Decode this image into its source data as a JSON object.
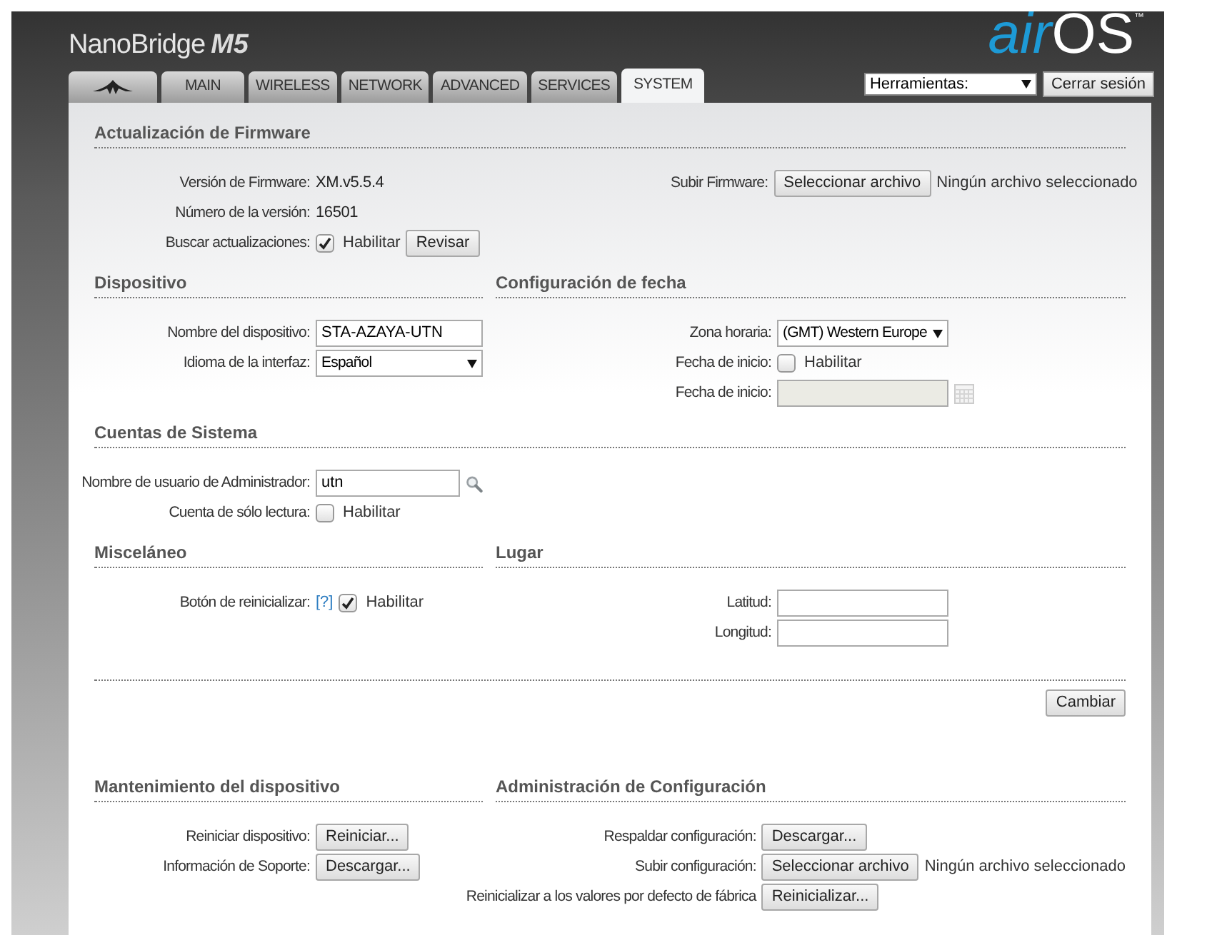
{
  "header": {
    "product": "NanoBridge",
    "model": "M5",
    "brand_air": "air",
    "brand_os": "OS",
    "trademark": "™"
  },
  "tabs": [
    {
      "kind": "logo",
      "selected": false
    },
    {
      "label": "MAIN",
      "selected": false
    },
    {
      "label": "WIRELESS",
      "selected": false
    },
    {
      "label": "NETWORK",
      "selected": false
    },
    {
      "label": "ADVANCED",
      "selected": false
    },
    {
      "label": "SERVICES",
      "selected": false
    },
    {
      "label": "SYSTEM",
      "selected": true
    }
  ],
  "tools": {
    "select": "Herramientas:",
    "logout": "Cerrar sesión"
  },
  "sections": [
    {
      "kind": "form",
      "headings": [
        "Actualización de Firmware"
      ],
      "columns": [
        [
          {
            "kind": "text",
            "label": "Versión de Firmware:",
            "value": "XM.v5.5.4"
          },
          {
            "kind": "text",
            "label": "Número de la versión:",
            "value": "16501"
          },
          {
            "kind": "checkbox",
            "label": "Buscar actualizaciones:",
            "checked": true,
            "option": "Habilitar",
            "button": "Revisar"
          }
        ],
        [
          {
            "kind": "file",
            "label": "Subir Firmware:",
            "button": "Seleccionar archivo",
            "status": "Ningún archivo seleccionado"
          }
        ]
      ]
    },
    {
      "kind": "form",
      "headings": [
        "Dispositivo",
        "Configuración de fecha"
      ],
      "columns": [
        [
          {
            "kind": "input",
            "label": "Nombre del dispositivo:",
            "value": "STA-AZAYA-UTN"
          },
          {
            "kind": "select",
            "label": "Idioma de la interfaz:",
            "value": "Español"
          }
        ],
        [
          {
            "kind": "select",
            "label": "Zona horaria:",
            "value": "(GMT) Western Europe"
          },
          {
            "kind": "checkbox",
            "label": "Fecha de inicio:",
            "checked": false,
            "option": "Habilitar"
          },
          {
            "kind": "date",
            "label": "Fecha de inicio:",
            "disabled": true
          }
        ]
      ]
    },
    {
      "kind": "form",
      "headings": [
        "Cuentas de Sistema"
      ],
      "columns": [
        [
          {
            "kind": "lookup",
            "label": "Nombre de usuario de Administrador:",
            "value": "utn"
          },
          {
            "kind": "checkbox",
            "label": "Cuenta de sólo lectura:",
            "checked": false,
            "option": "Habilitar"
          }
        ]
      ]
    },
    {
      "kind": "form",
      "headings": [
        "Misceláneo",
        "Lugar"
      ],
      "columns": [
        [
          {
            "kind": "checkbox",
            "label": "Botón de reinicializar:",
            "help": "[?]",
            "checked": true,
            "option": "Habilitar"
          }
        ],
        [
          {
            "kind": "input",
            "label": "Latitud:"
          },
          {
            "kind": "input",
            "label": "Longitud:"
          }
        ]
      ]
    },
    {
      "kind": "apply",
      "button": "Cambiar"
    },
    {
      "kind": "form",
      "headings": [
        "Mantenimiento del dispositivo",
        "Administración de Configuración"
      ],
      "columns": [
        [
          {
            "kind": "button",
            "label": "Reiniciar dispositivo:",
            "button": "Reiniciar..."
          },
          {
            "kind": "button",
            "label": "Información de Soporte:",
            "button": "Descargar..."
          }
        ],
        [
          {
            "kind": "button",
            "label": "Respaldar configuración:",
            "button": "Descargar..."
          },
          {
            "kind": "file",
            "label": "Subir configuración:",
            "button": "Seleccionar archivo",
            "status": "Ningún archivo seleccionado"
          },
          {
            "kind": "button",
            "label": "Reinicializar a los valores por defecto de fábrica",
            "button": "Reinicializar..."
          }
        ]
      ]
    }
  ]
}
